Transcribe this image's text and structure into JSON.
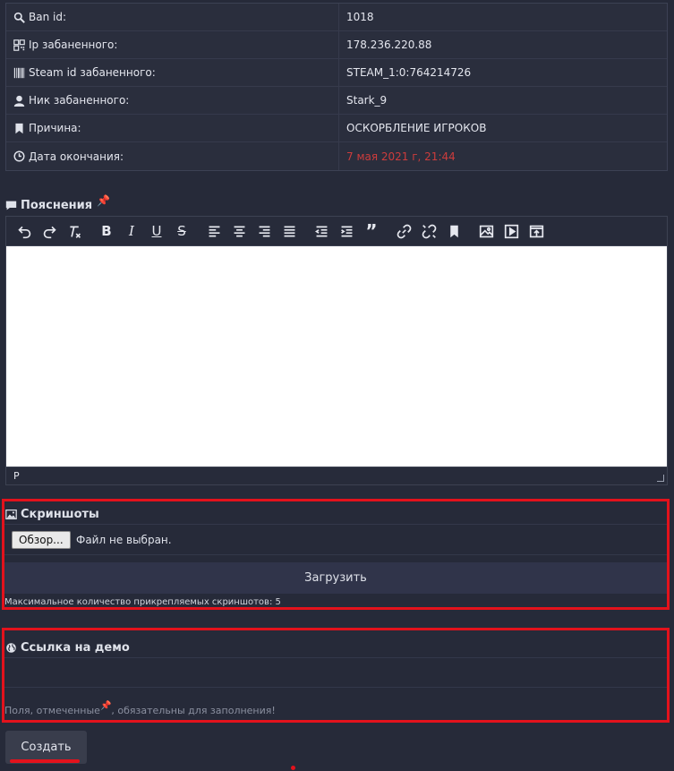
{
  "ban_info": [
    {
      "icon": "search-icon",
      "label": "Ban id:",
      "value": "1018"
    },
    {
      "icon": "qrcode-icon",
      "label": "Ip забаненного:",
      "value": "178.236.220.88"
    },
    {
      "icon": "barcode-icon",
      "label": "Steam id забаненного:",
      "value": "STEAM_1:0:764214726"
    },
    {
      "icon": "user-icon",
      "label": "Ник забаненного:",
      "value": "Stark_9"
    },
    {
      "icon": "bookmark-icon",
      "label": "Причина:",
      "value": "ОСКОРБЛЕНИЕ ИГРОКОВ"
    },
    {
      "icon": "clock-icon",
      "label": "Дата окончания:",
      "value": "7 мая 2021 г, 21:44",
      "color": "#cc3c3c"
    }
  ],
  "explanation": {
    "title": "Пояснения",
    "required_mark": "📌",
    "editor_status_path": "P"
  },
  "toolbar_buttons": [
    "undo-icon",
    "redo-icon",
    "clear-format-icon",
    "bold-icon",
    "italic-icon",
    "underline-icon",
    "strikethrough-icon",
    "align-left-icon",
    "align-center-icon",
    "align-right-icon",
    "align-justify-icon",
    "outdent-icon",
    "indent-icon",
    "blockquote-icon",
    "link-icon",
    "unlink-icon",
    "anchor-icon",
    "image-icon",
    "media-icon",
    "preview-icon"
  ],
  "screenshots": {
    "title": "Скриншоты",
    "browse_label": "Обзор...",
    "file_status": "Файл не выбран.",
    "upload_label": "Загрузить",
    "limit_note": "Максимальное количество прикрепляемых скриншотов: 5"
  },
  "demo": {
    "title": "Ссылка на демо",
    "required_note_before": "Поля, отмеченные",
    "required_note_after": ", обязательны для заполнения!",
    "required_mark": "📌"
  },
  "submit": {
    "label": "Создать"
  },
  "colors": {
    "background": "#262a39",
    "highlight": "#e3121c",
    "date_red": "#cc3c3c"
  }
}
